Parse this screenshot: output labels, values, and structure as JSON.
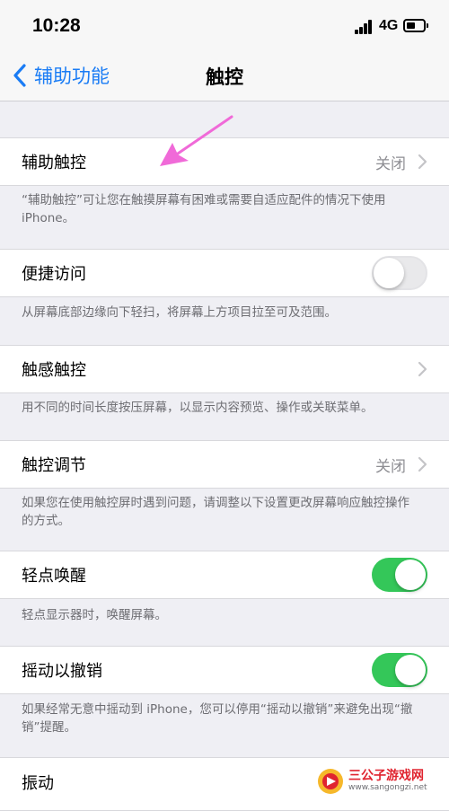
{
  "status_bar": {
    "time": "10:28",
    "network": "4G"
  },
  "nav": {
    "back_label": "辅助功能",
    "title": "触控"
  },
  "settings": {
    "assistive_touch": {
      "label": "辅助触控",
      "value": "关闭",
      "footer": "“辅助触控”可让您在触摸屏幕有困难或需要自适应配件的情况下使用 iPhone。"
    },
    "reachability": {
      "label": "便捷访问",
      "enabled": false,
      "footer": "从屏幕底部边缘向下轻扫，将屏幕上方项目拉至可及范围。"
    },
    "haptic_touch": {
      "label": "触感触控",
      "footer": "用不同的时间长度按压屏幕，以显示内容预览、操作或关联菜单。"
    },
    "touch_accommodations": {
      "label": "触控调节",
      "value": "关闭",
      "footer": "如果您在使用触控屏时遇到问题，请调整以下设置更改屏幕响应触控操作的方式。"
    },
    "tap_to_wake": {
      "label": "轻点唤醒",
      "enabled": true,
      "footer": "轻点显示器时，唤醒屏幕。"
    },
    "shake_to_undo": {
      "label": "摇动以撤销",
      "enabled": true,
      "footer": "如果经常无意中摇动到 iPhone，您可以停用“摇动以撤销”来避免出现“撤销”提醒。"
    },
    "vibration": {
      "label": "振动"
    }
  },
  "watermark": {
    "name": "三公子游戏网",
    "url": "www.sangongzi.net"
  },
  "colors": {
    "accent": "#1a7cf5",
    "toggle_on": "#34c759",
    "arrow": "#f06ad8"
  }
}
